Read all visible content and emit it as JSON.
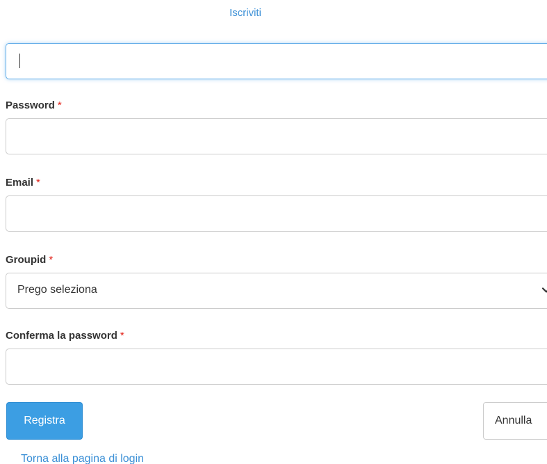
{
  "header": {
    "title_link": "Iscriviti"
  },
  "form": {
    "username": {
      "value": ""
    },
    "password": {
      "label": "Password",
      "required_mark": "*",
      "value": ""
    },
    "email": {
      "label": "Email",
      "required_mark": "*",
      "value": ""
    },
    "groupid": {
      "label": "Groupid",
      "required_mark": "*",
      "selected": "Prego seleziona"
    },
    "confirm_password": {
      "label": "Conferma la password",
      "required_mark": "*",
      "value": ""
    }
  },
  "actions": {
    "submit_label": "Registra",
    "cancel_label": "Annulla",
    "back_link": "Torna alla pagina di login"
  },
  "colors": {
    "accent": "#3c9ee3",
    "link": "#3a8fd6",
    "required": "#e2231a"
  },
  "icons": {
    "select_arrow": "chevron-down-icon"
  }
}
